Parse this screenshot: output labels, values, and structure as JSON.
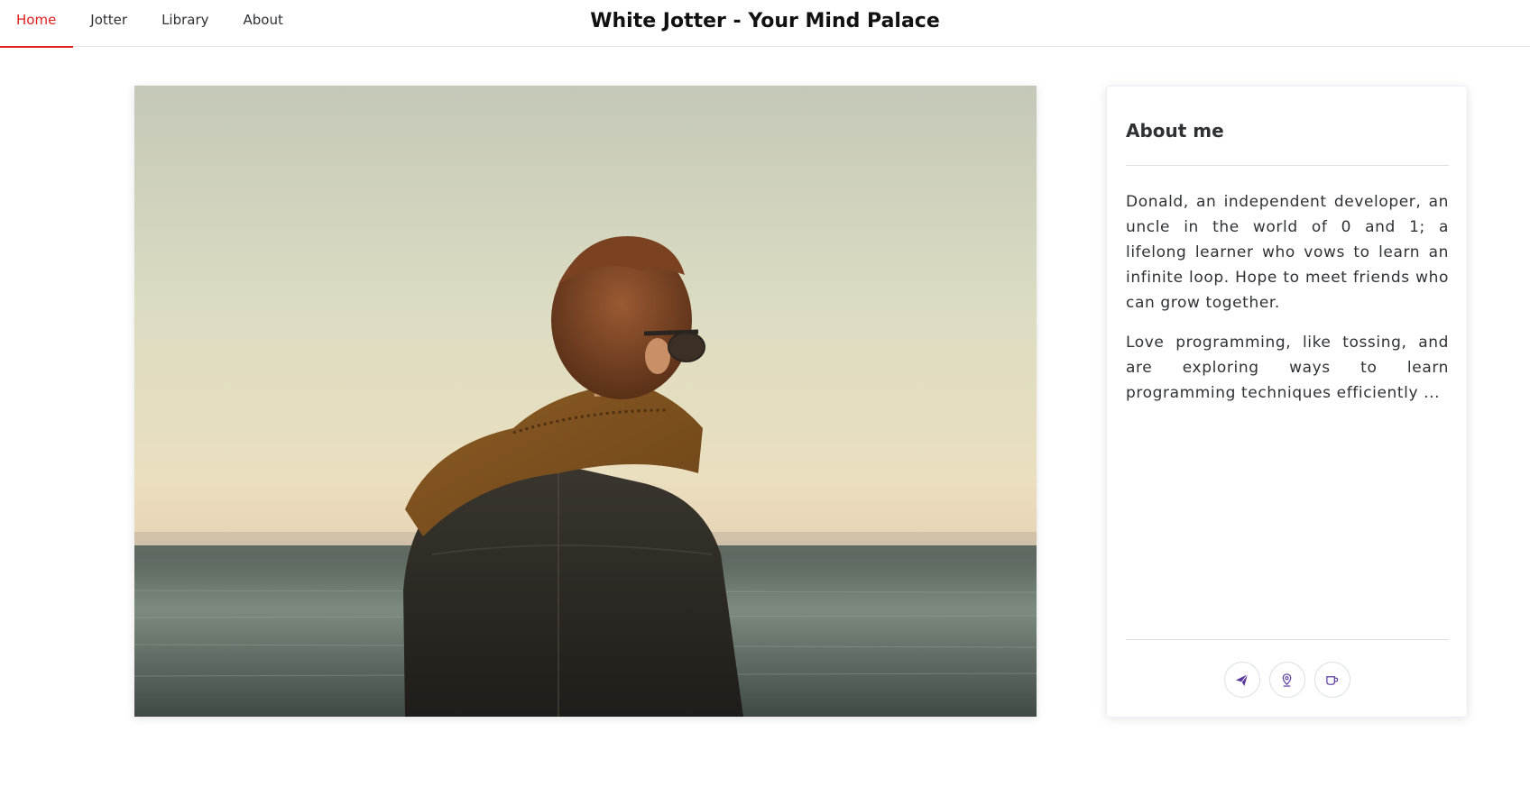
{
  "header": {
    "nav": [
      {
        "label": "Home",
        "active": true
      },
      {
        "label": "Jotter",
        "active": false
      },
      {
        "label": "Library",
        "active": false
      },
      {
        "label": "About",
        "active": false
      }
    ],
    "title": "White Jotter - Your Mind Palace",
    "accent_color": "#e0201f"
  },
  "hero": {
    "image": "photo of a person in a leather jacket and scarf looking at the sea at sunset"
  },
  "about_card": {
    "title": "About me",
    "paragraphs": [
      "Donald, an independent developer, an uncle in the world of 0 and 1; a lifelong learner who vows to learn an infinite loop. Hope to meet friends who can grow together.",
      "Love programming, like tossing, and are exploring ways to learn programming techniques efficiently ..."
    ],
    "icons": [
      "send-icon",
      "location-icon",
      "coffee-icon"
    ],
    "icon_color": "#5b3a9e"
  }
}
